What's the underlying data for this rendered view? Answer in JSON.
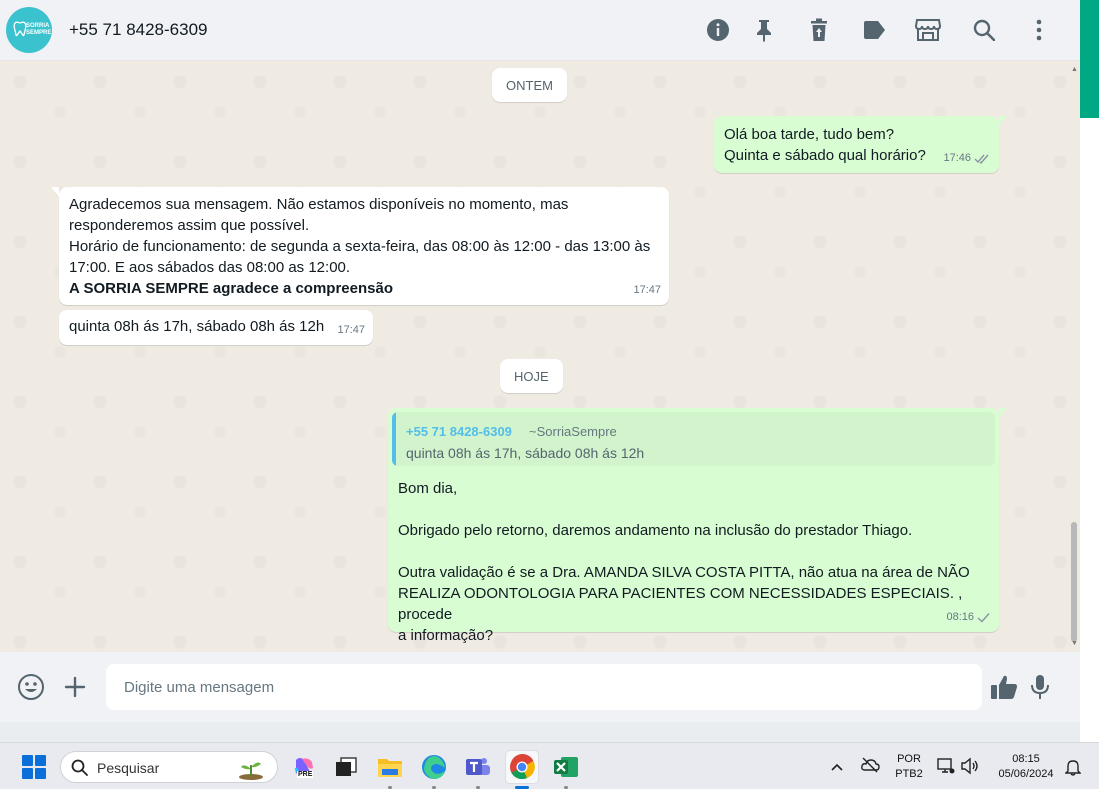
{
  "header": {
    "avatar_text": "SORRIA SEMPRE",
    "contact_name": "+55 71 8428-6309",
    "icons": [
      "info-icon",
      "pin-icon",
      "delete-icon",
      "label-icon",
      "store-icon",
      "search-icon",
      "menu-icon"
    ]
  },
  "chat": {
    "date_yesterday": "ONTEM",
    "date_today": "HOJE",
    "messages": [
      {
        "direction": "out",
        "lines": [
          "Olá boa tarde, tudo bem?",
          "Quinta e sábado qual horário?"
        ],
        "time": "17:46",
        "status": "read"
      },
      {
        "direction": "in",
        "lines": [
          "Agradecemos sua mensagem. Não estamos disponíveis no momento, mas",
          "responderemos assim que possível.",
          "Horário de funcionamento: de segunda a sexta-feira, das 08:00 às 12:00 - das 13:00 às",
          "17:00. E aos sábados das 08:00 as 12:00."
        ],
        "bold_line": "A SORRIA SEMPRE agradece a compreensão",
        "time": "17:47"
      },
      {
        "direction": "in",
        "lines": [
          "quinta 08h ás 17h, sábado 08h ás 12h"
        ],
        "time": "17:47"
      },
      {
        "direction": "out",
        "quote": {
          "name": "+55 71 8428-6309",
          "pushname": "~SorriaSempre",
          "text": "quinta 08h ás 17h, sábado 08h ás 12h"
        },
        "lines": [
          "Bom dia,",
          "",
          "Obrigado pelo retorno, daremos andamento na inclusão do prestador Thiago.",
          "",
          "Outra validação é se a Dra. AMANDA SILVA COSTA PITTA, não atua na área de NÃO",
          "REALIZA ODONTOLOGIA PARA PACIENTES COM NECESSIDADES ESPECIAIS. , procede",
          "a informação?"
        ],
        "time": "08:16",
        "status": "sent"
      }
    ]
  },
  "composer": {
    "placeholder": "Digite uma mensagem",
    "value": "",
    "icons": [
      "emoji-icon",
      "attach-plus-icon",
      "thumbs-up-icon",
      "microphone-icon"
    ]
  },
  "taskbar": {
    "search_label": "Pesquisar",
    "copilot_badge": "PRE",
    "lang_top": "POR",
    "lang_bottom": "PTB2",
    "time": "08:15",
    "date": "05/06/2024",
    "colors": {
      "accent": "#0a6fd8",
      "whatsapp": "#00a884"
    }
  }
}
